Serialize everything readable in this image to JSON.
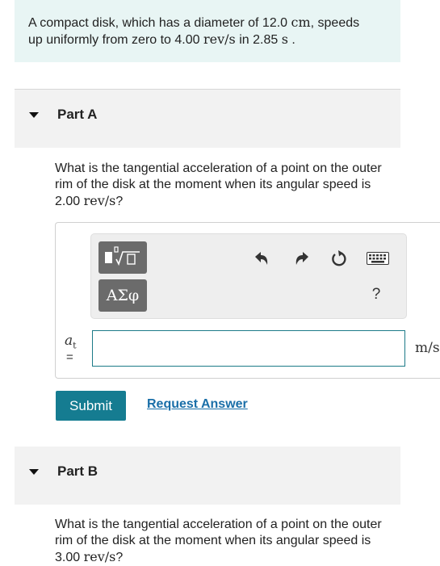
{
  "problem": {
    "line1_a": "A compact disk, which has a diameter of 12.0 ",
    "line1_unit": "cm",
    "line1_b": ", speeds",
    "line2_a": "up uniformly from zero to 4.00 ",
    "line2_unit": "rev/s",
    "line2_b": " in 2.85 ",
    "line2_unit2": "s",
    "line2_c": " ."
  },
  "part_a": {
    "title": "Part A",
    "question_line1": "What is the tangential acceleration of a point on the outer",
    "question_line2": "rim of the disk at the moment when its angular speed is",
    "question_value": "2.00 ",
    "question_unit": "rev/s",
    "question_end": "?",
    "toolbar": {
      "greek_label": "ΑΣφ",
      "help_label": "?",
      "icons": [
        "templates-icon",
        "undo-icon",
        "redo-icon",
        "reset-icon",
        "keyboard-icon"
      ]
    },
    "variable": "a",
    "variable_sub": "t",
    "equals": "=",
    "answer_value": "",
    "unit": "m/s",
    "submit_label": "Submit",
    "request_label": "Request Answer"
  },
  "part_b": {
    "title": "Part B",
    "question_line1": "What is the tangential acceleration of a point on the outer",
    "question_line2": "rim of the disk at the moment when its angular speed is",
    "question_value": "3.00 ",
    "question_unit": "rev/s",
    "question_end": "?"
  },
  "colors": {
    "intro_bg": "#e8f5f4",
    "submit_bg": "#157c91",
    "link": "#1a6fa8",
    "input_border": "#1c7a88"
  }
}
